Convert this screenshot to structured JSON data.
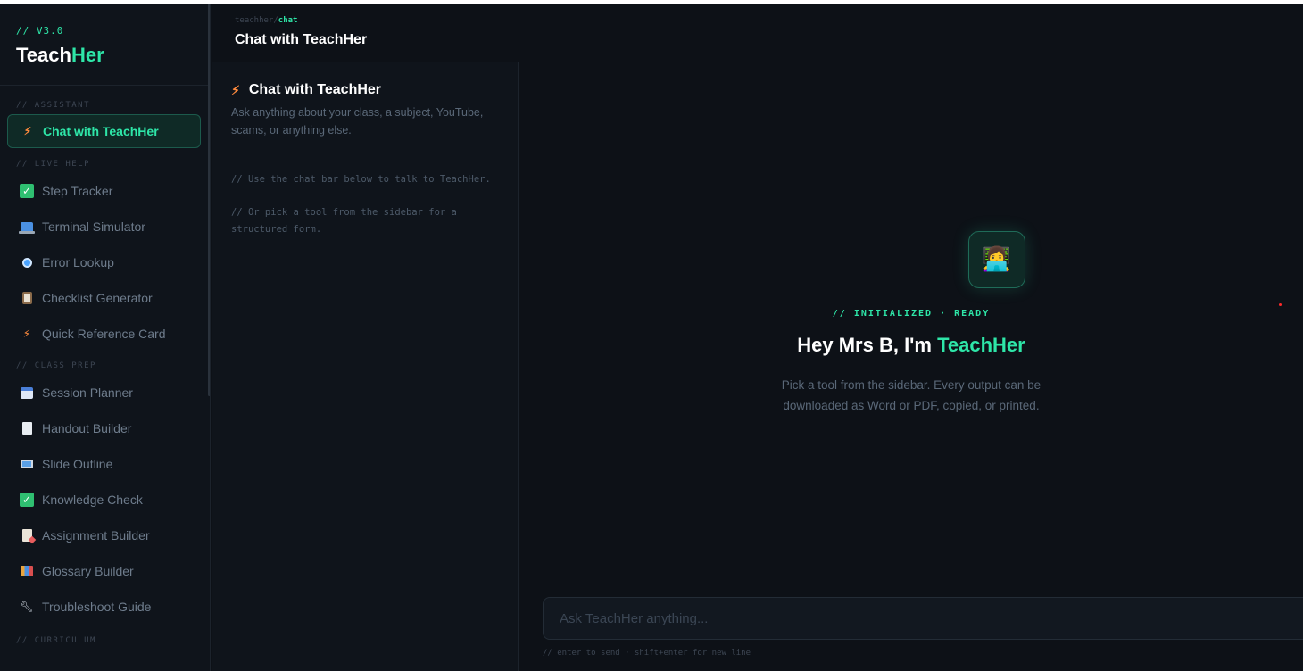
{
  "brand": {
    "version": "// V3.0",
    "name_main": "Teach",
    "name_accent": "Her"
  },
  "sidebar": {
    "sections": [
      {
        "label": "// ASSISTANT",
        "items": [
          {
            "label": "Chat with TeachHer",
            "icon": "bolt-icon"
          }
        ]
      },
      {
        "label": "// LIVE HELP",
        "items": [
          {
            "label": "Step Tracker",
            "icon": "check-box-icon"
          },
          {
            "label": "Terminal Simulator",
            "icon": "laptop-icon"
          },
          {
            "label": "Error Lookup",
            "icon": "magnifier-icon"
          },
          {
            "label": "Checklist Generator",
            "icon": "clipboard-icon"
          },
          {
            "label": "Quick Reference Card",
            "icon": "bolt-icon"
          }
        ]
      },
      {
        "label": "// CLASS PREP",
        "items": [
          {
            "label": "Session Planner",
            "icon": "calendar-icon"
          },
          {
            "label": "Handout Builder",
            "icon": "document-icon"
          },
          {
            "label": "Slide Outline",
            "icon": "desktop-icon"
          },
          {
            "label": "Knowledge Check",
            "icon": "check-box-icon"
          },
          {
            "label": "Assignment Builder",
            "icon": "memo-icon"
          },
          {
            "label": "Glossary Builder",
            "icon": "books-icon"
          },
          {
            "label": "Troubleshoot Guide",
            "icon": "wrench-icon"
          }
        ]
      },
      {
        "label": "// CURRICULUM",
        "items": []
      }
    ]
  },
  "header": {
    "breadcrumb_root": "teachher/",
    "breadcrumb_current": "chat",
    "title": "Chat with TeachHer"
  },
  "panel": {
    "title": "Chat with TeachHer",
    "description": "Ask anything about your class, a subject, YouTube, scams, or anything else.",
    "note_1": "// Use the chat bar below to talk to TeachHer.",
    "note_2": "// Or pick a tool from the sidebar for a structured form."
  },
  "main": {
    "hero_icon": "woman-technologist-icon",
    "status": "// INITIALIZED · READY",
    "greeting_prefix": "Hey Mrs B, I'm ",
    "greeting_accent": "TeachHer",
    "subtitle_line1": "Pick a tool from the sidebar. Every output can be",
    "subtitle_line2": "downloaded as Word or PDF, copied, or printed."
  },
  "chat": {
    "placeholder": "Ask TeachHer anything...",
    "value": "",
    "hint": "// enter to send · shift+enter for new line"
  },
  "colors": {
    "accent": "#2ee6a8",
    "background": "#0d1117",
    "sidebar": "#0f141b"
  }
}
